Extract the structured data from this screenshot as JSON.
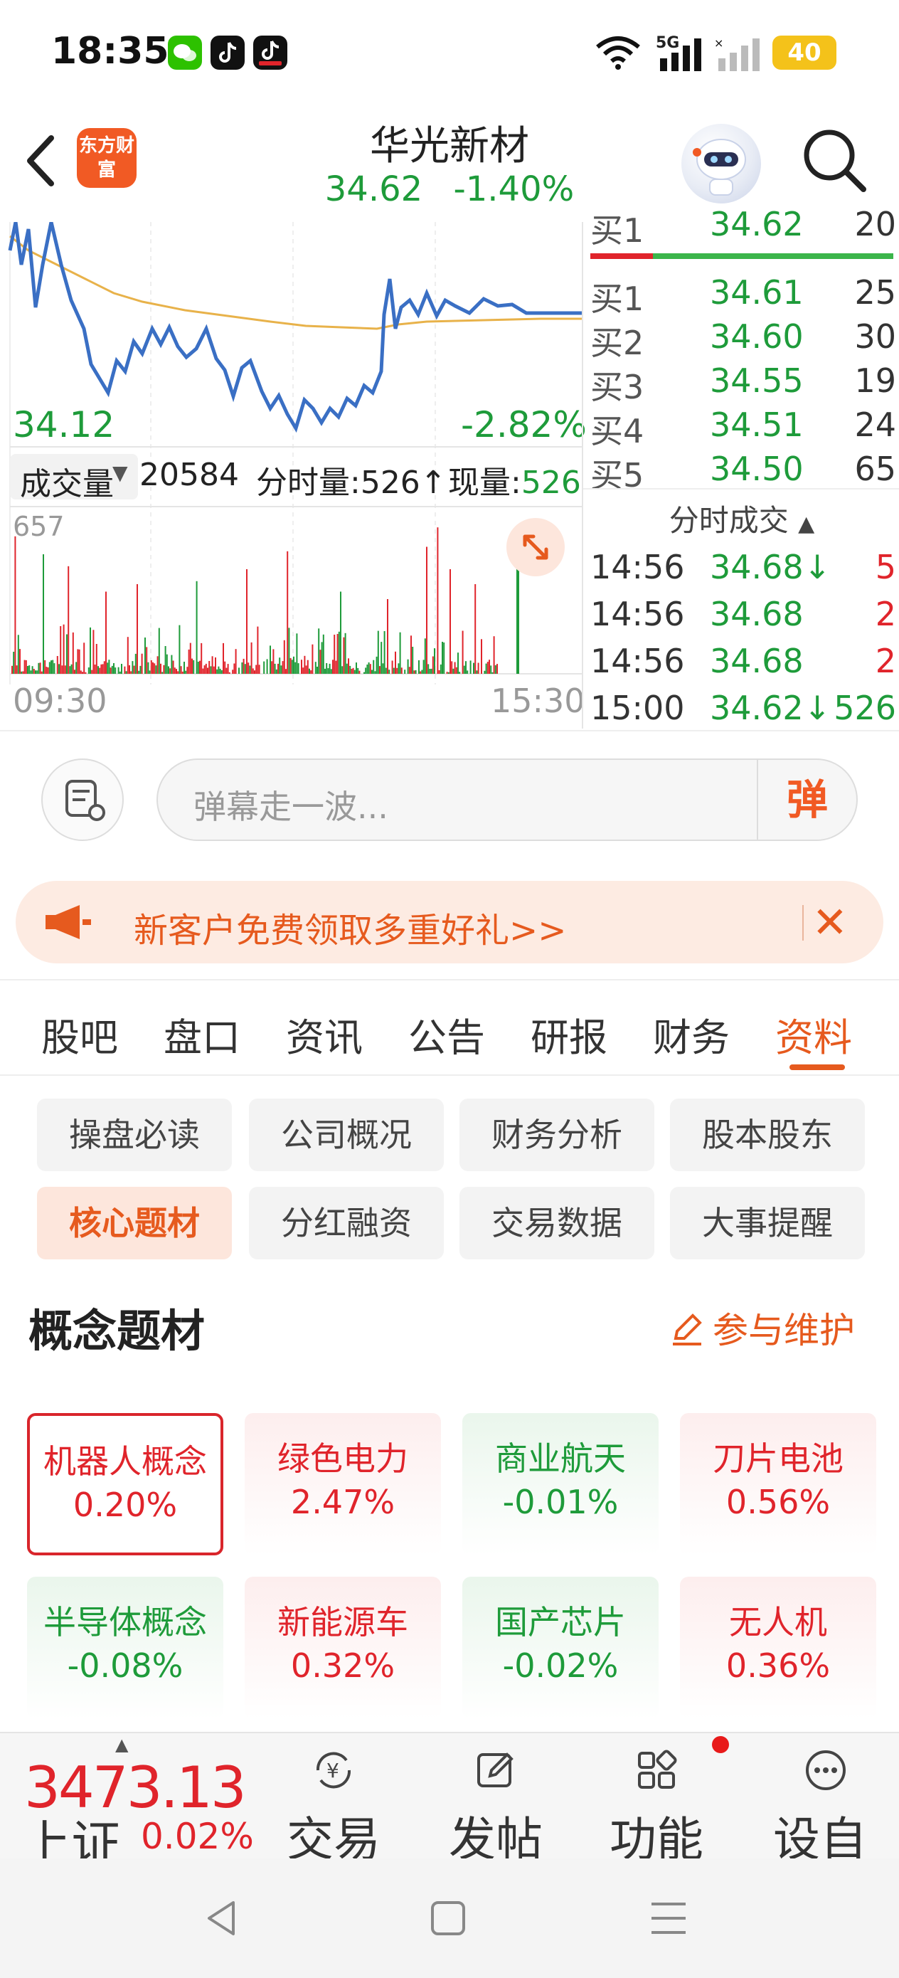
{
  "status_bar": {
    "time": "18:35",
    "network": "5G",
    "battery": "40",
    "apps": [
      {
        "icon": "wechat-icon",
        "color": "#2dc100"
      },
      {
        "icon": "tiktok-icon",
        "color": "#111111"
      },
      {
        "icon": "tiktok-lite-icon",
        "color": "#111111"
      }
    ]
  },
  "header": {
    "back_icon": "back-arrow-icon",
    "logo_text": "东方财富",
    "stock_name": "华光新材",
    "price": "34.62",
    "change_pct": "-1.40%",
    "search_icon": "search-icon"
  },
  "chart": {
    "low_price": "34.12",
    "low_pct": "-2.82%",
    "volume_selector": "成交量",
    "volume_total": "20584",
    "tick_volume_label": "分时量:526↑",
    "current_volume_label": "现量:",
    "current_volume_value": "526",
    "vol_max": "657",
    "time_start": "09:30",
    "time_end": "15:30",
    "colors": {
      "price_line": "#3a6fc4",
      "avg_line": "#e8b24a",
      "up": "#e0242b",
      "down": "#1e9b3a"
    }
  },
  "order_book": {
    "cut_label": "买1",
    "cut_price": "34.62",
    "cut_vol": "20",
    "bids": [
      {
        "label": "买1",
        "price": "34.61",
        "volume": "25"
      },
      {
        "label": "买2",
        "price": "34.60",
        "volume": "30"
      },
      {
        "label": "买3",
        "price": "34.55",
        "volume": "19"
      },
      {
        "label": "买4",
        "price": "34.51",
        "volume": "24"
      },
      {
        "label": "买5",
        "price": "34.50",
        "volume": "65"
      }
    ],
    "trades_title": "分时成交",
    "trades": [
      {
        "time": "14:56",
        "price": "34.68↓",
        "volume": "5",
        "vol_color": "red"
      },
      {
        "time": "14:56",
        "price": "34.68",
        "volume": "2",
        "vol_color": "red"
      },
      {
        "time": "14:56",
        "price": "34.68",
        "volume": "2",
        "vol_color": "red"
      },
      {
        "time": "15:00",
        "price": "34.62↓",
        "volume": "526",
        "vol_color": "green"
      }
    ]
  },
  "danmu": {
    "placeholder": "弹幕走一波...",
    "send_label": "弹"
  },
  "promo": {
    "text": "新客户免费领取多重好礼>>"
  },
  "tabs": [
    "股吧",
    "盘口",
    "资讯",
    "公告",
    "研报",
    "财务",
    "资料"
  ],
  "active_tab": "资料",
  "sub_buttons": [
    "操盘必读",
    "公司概况",
    "财务分析",
    "股本股东",
    "核心题材",
    "分红融资",
    "交易数据",
    "大事提醒"
  ],
  "active_sub_button": "核心题材",
  "concepts_section": {
    "title": "概念题材",
    "maintain_label": "参与维护",
    "items": [
      {
        "name": "机器人概念",
        "pct": "0.20%",
        "trend": "up",
        "selected": true
      },
      {
        "name": "绿色电力",
        "pct": "2.47%",
        "trend": "up",
        "selected": false
      },
      {
        "name": "商业航天",
        "pct": "-0.01%",
        "trend": "down",
        "selected": false
      },
      {
        "name": "刀片电池",
        "pct": "0.56%",
        "trend": "up",
        "selected": false
      },
      {
        "name": "半导体概念",
        "pct": "-0.08%",
        "trend": "down",
        "selected": false
      },
      {
        "name": "新能源车",
        "pct": "0.32%",
        "trend": "up",
        "selected": false
      },
      {
        "name": "国产芯片",
        "pct": "-0.02%",
        "trend": "down",
        "selected": false
      },
      {
        "name": "无人机",
        "pct": "0.36%",
        "trend": "up",
        "selected": false
      }
    ]
  },
  "bottom_bar": {
    "index_value": "3473.13",
    "index_name": "上证",
    "index_change": "0.02%",
    "items": [
      {
        "label": "交易",
        "icon": "yen-exchange-icon"
      },
      {
        "label": "发帖",
        "icon": "edit-icon"
      },
      {
        "label": "功能",
        "icon": "apps-grid-icon"
      },
      {
        "label": "设自选",
        "icon": "more-dots-icon"
      }
    ]
  }
}
